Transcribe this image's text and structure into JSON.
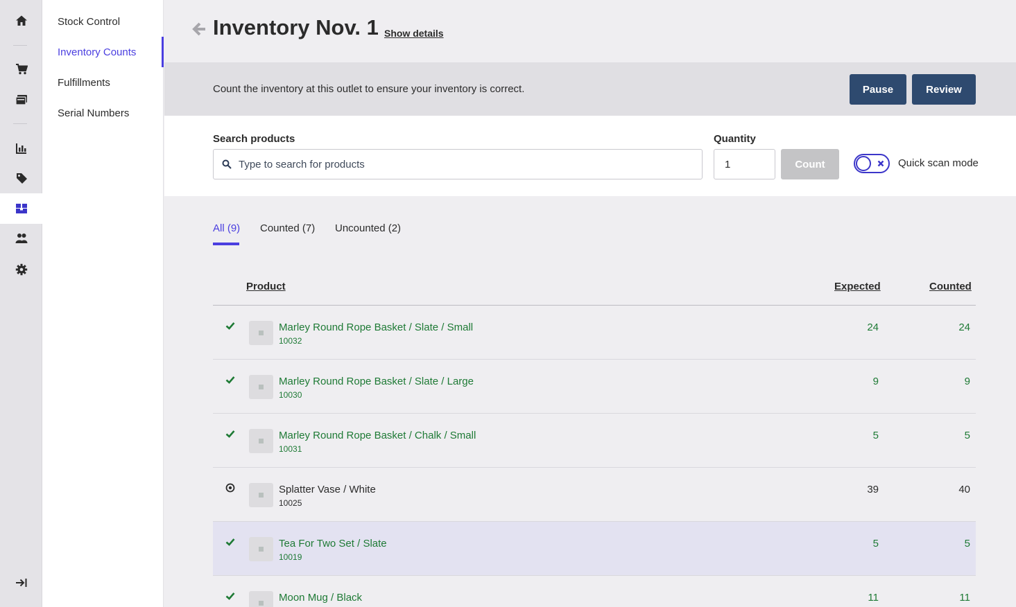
{
  "colors": {
    "accent": "#4a3ee0",
    "button_dark": "#2e4a6f",
    "counted_green": "#1e7a35"
  },
  "rail": {
    "items": [
      {
        "icon": "home-icon"
      },
      {
        "icon": "cart-icon"
      },
      {
        "icon": "register-icon"
      },
      {
        "icon": "chart-icon"
      },
      {
        "icon": "tag-icon"
      },
      {
        "icon": "inventory-icon",
        "active": true
      },
      {
        "icon": "customers-icon"
      },
      {
        "icon": "gear-icon"
      },
      {
        "icon": "expand-sidebar-icon"
      }
    ]
  },
  "subnav": {
    "items": [
      {
        "label": "Stock Control"
      },
      {
        "label": "Inventory Counts",
        "active": true
      },
      {
        "label": "Fulfillments"
      },
      {
        "label": "Serial Numbers"
      }
    ]
  },
  "header": {
    "title": "Inventory Nov. 1",
    "show_details": "Show details"
  },
  "banner": {
    "text": "Count the inventory at this outlet to ensure your inventory is correct.",
    "pause": "Pause",
    "review": "Review"
  },
  "search": {
    "label": "Search products",
    "placeholder": "Type to search for products",
    "quantity_label": "Quantity",
    "quantity_value": "1",
    "count_button": "Count",
    "quick_scan_label": "Quick scan mode",
    "quick_scan_enabled": false
  },
  "tabs": [
    {
      "label": "All (9)",
      "active": true
    },
    {
      "label": "Counted (7)"
    },
    {
      "label": "Uncounted (2)"
    }
  ],
  "table": {
    "columns": {
      "product": "Product",
      "expected": "Expected",
      "counted": "Counted"
    },
    "rows": [
      {
        "status": "check",
        "name": "Marley Round Rope Basket / Slate / Small",
        "sku": "10032",
        "expected": "24",
        "counted": "24",
        "tone": "green"
      },
      {
        "status": "check",
        "name": "Marley Round Rope Basket / Slate / Large",
        "sku": "10030",
        "expected": "9",
        "counted": "9",
        "tone": "green"
      },
      {
        "status": "check",
        "name": "Marley Round Rope Basket / Chalk / Small",
        "sku": "10031",
        "expected": "5",
        "counted": "5",
        "tone": "green"
      },
      {
        "status": "target",
        "name": "Splatter Vase / White",
        "sku": "10025",
        "expected": "39",
        "counted": "40",
        "tone": "neutral"
      },
      {
        "status": "check",
        "name": "Tea For Two Set / Slate",
        "sku": "10019",
        "expected": "5",
        "counted": "5",
        "tone": "green",
        "highlight": true
      },
      {
        "status": "check",
        "name": "Moon Mug / Black",
        "sku": "",
        "expected": "11",
        "counted": "11",
        "tone": "green"
      }
    ]
  }
}
